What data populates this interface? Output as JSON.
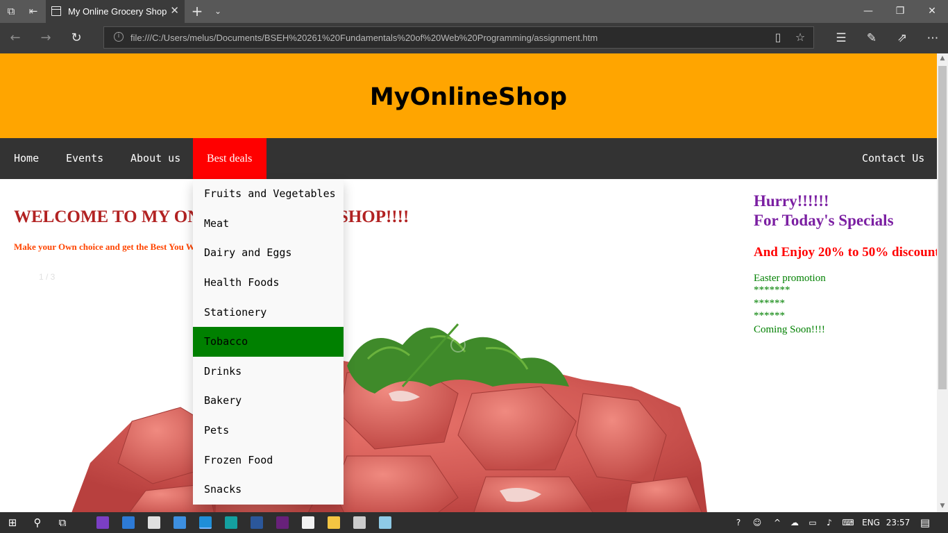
{
  "browser": {
    "tab_title": "My Online Grocery Shop",
    "address": "file:///C:/Users/melus/Documents/BSEH%20261%20Fundamentals%20of%20Web%20Programming/assignment.htm",
    "icons": [
      "tab-list-icon",
      "set-aside-icon",
      "new-tab-icon",
      "chevron-down-icon",
      "back-icon",
      "forward-icon",
      "refresh-icon",
      "reading-view-icon",
      "favorite-star-icon",
      "favorites-icon",
      "pen-icon",
      "share-icon",
      "more-icon"
    ]
  },
  "site": {
    "title": "MyOnlineShop",
    "nav": {
      "home": "Home",
      "events": "Events",
      "about": "About us",
      "best_deals": "Best deals",
      "contact": "Contact Us"
    },
    "dropdown": [
      "Fruits and Vegetables",
      "Meat",
      "Dairy and Eggs",
      "Health Foods",
      "Stationery",
      "Tobacco",
      "Drinks",
      "Bakery",
      "Pets",
      "Frozen Food",
      "Snacks"
    ],
    "dropdown_active": "Tobacco",
    "welcome": "WELCOME TO MY ONLINE GROCERY SHOP!!!!",
    "tagline": "Make your Own choice and get the Best You Want",
    "slide_counter": "1 / 3",
    "specials": {
      "hurry": "Hurry!!!!!!",
      "for_today": "For Today's Specials",
      "enjoy": "And Enjoy 20% to 50% discount",
      "promo": [
        "Easter promotion",
        "*******",
        "******",
        "******",
        "Coming Soon!!!!"
      ]
    }
  },
  "colors": {
    "header_bg": "#ffa500",
    "nav_bg": "#333333",
    "nav_active": "#ff0000",
    "dropdown_hover": "#008000",
    "welcome": "#b22222",
    "tagline": "#ff4500",
    "specials_title": "#7b1fa2",
    "discount": "#ff0000",
    "promo": "#008000"
  },
  "taskbar": {
    "language": "ENG",
    "time": "23:57"
  }
}
